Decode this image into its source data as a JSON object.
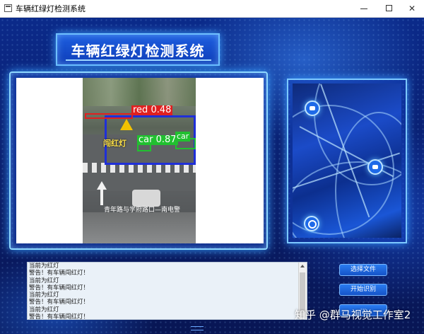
{
  "window": {
    "title": "车辆红绿灯检测系统",
    "controls": [
      "minimize",
      "maximize",
      "close"
    ]
  },
  "header": {
    "title": "车辆红绿灯检测系统"
  },
  "video": {
    "detections": [
      {
        "label": "red 0.48",
        "color": "#e02020"
      },
      {
        "label": "car 0.87",
        "color": "#21c030"
      },
      {
        "label": "car",
        "color": "#21c030"
      }
    ],
    "overlay_text": "闯红灯",
    "caption": "青年路与学府路口—南电警",
    "vehicle_zone_color": "#1f2fd8"
  },
  "log": {
    "lines": [
      "当前为红灯",
      "警告！有车辆闯红灯！",
      "当前为红灯",
      "警告！有车辆闯红灯！",
      "当前为红灯",
      "警告！有车辆闯红灯！",
      "当前为红灯",
      "警告！有车辆闯红灯！"
    ]
  },
  "buttons": {
    "select_file": "选择文件",
    "start_recognition": "开始识别",
    "third": "···"
  },
  "side_image": {
    "icons": [
      "car-icon",
      "bus-icon",
      "search-icon"
    ]
  },
  "watermark": "知乎 @群马视觉工作室2",
  "colors": {
    "accent": "#1e6ae8",
    "background": "#0a1f6e",
    "glow": "#8fd8ff"
  }
}
